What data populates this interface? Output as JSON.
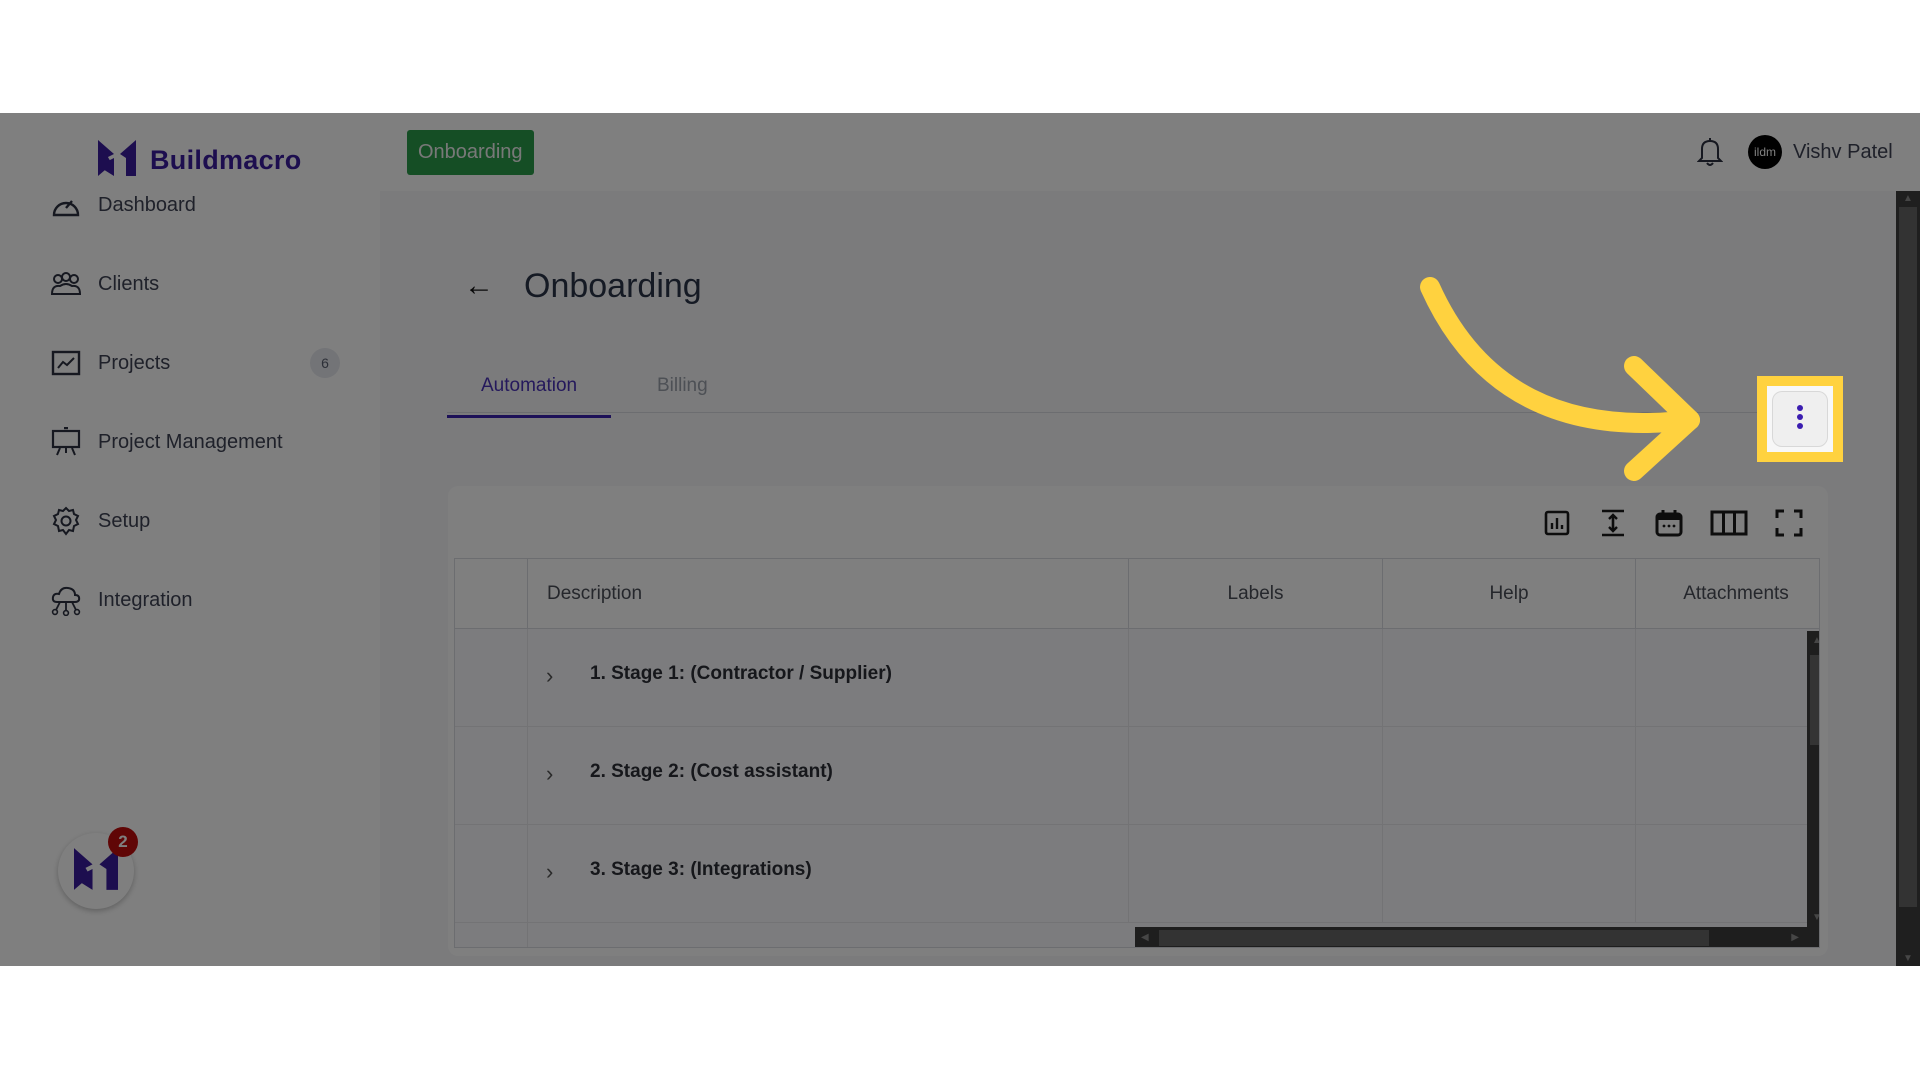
{
  "brand": {
    "name": "Buildmacro",
    "accent": "#3b1d9e"
  },
  "sidebar": {
    "items": [
      {
        "label": "Dashboard",
        "icon": "dashboard-gauge-icon"
      },
      {
        "label": "Clients",
        "icon": "users-group-icon"
      },
      {
        "label": "Projects",
        "icon": "chart-line-icon",
        "badge": "6"
      },
      {
        "label": "Project Management",
        "icon": "presentation-board-icon"
      },
      {
        "label": "Setup",
        "icon": "gear-icon"
      },
      {
        "label": "Integration",
        "icon": "cloud-network-icon"
      }
    ],
    "collapse_glyph": "‹",
    "fab_badge": "2"
  },
  "header": {
    "breadcrumb": "Onboarding",
    "breadcrumb_color": "#2a9d4a",
    "avatar_text": "ildm",
    "user_name": "Vishv Patel"
  },
  "main": {
    "back_glyph": "←",
    "title": "Onboarding",
    "tabs": [
      {
        "label": "Automation",
        "active": true
      },
      {
        "label": "Billing",
        "active": false
      }
    ],
    "toolbar": [
      "chart-icon",
      "row-height-icon",
      "calendar-icon",
      "columns-icon",
      "fullscreen-icon"
    ],
    "table": {
      "columns": [
        "",
        "Description",
        "Labels",
        "Help",
        "Attachments"
      ],
      "rows": [
        {
          "description": "1. Stage 1: (Contractor / Supplier)"
        },
        {
          "description": "2. Stage 2: (Cost assistant)"
        },
        {
          "description": "3. Stage 3: (Integrations)"
        }
      ]
    }
  },
  "annotation": {
    "highlight_color": "#ffd23f",
    "target": "more-options-button"
  }
}
